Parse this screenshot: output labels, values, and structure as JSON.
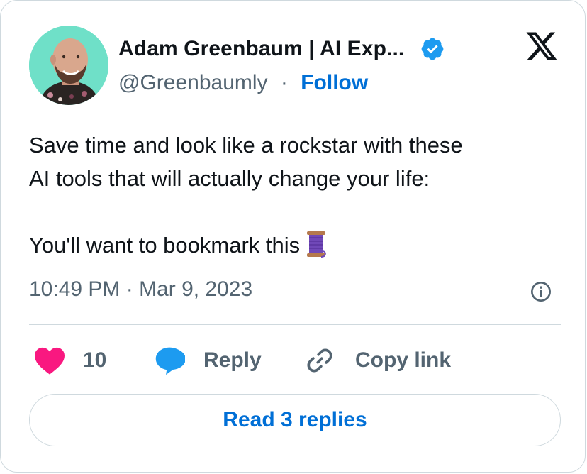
{
  "author": {
    "name": "Adam Greenbaum | AI Exp...",
    "handle": "@Greenbaumly",
    "separator": "·",
    "follow_label": "Follow",
    "verified": true
  },
  "icons": {
    "avatar": "profile-photo",
    "verified": "verified-badge-icon",
    "platform": "x-logo-icon",
    "thread": "spool-of-thread-emoji",
    "info": "info-icon",
    "like": "heart-icon",
    "reply": "speech-bubble-icon",
    "copy": "link-icon"
  },
  "tweet": {
    "lines": [
      "Save time and look like a rockstar with these",
      "AI tools that will actually change your life:",
      "",
      "You'll want to bookmark this"
    ],
    "timestamp": "10:49 PM · Mar 9, 2023"
  },
  "actions": {
    "like_count": "10",
    "reply_label": "Reply",
    "copy_label": "Copy link"
  },
  "footer": {
    "read_replies_label": "Read 3 replies"
  },
  "colors": {
    "text_primary": "#0f1419",
    "text_secondary": "#536471",
    "link_blue": "#006fd6",
    "verified_blue": "#1d9bf0",
    "heart_pink": "#f91880",
    "reply_blue": "#1d9bf0",
    "avatar_bg": "#6fe0c8",
    "border": "#cfd9de"
  }
}
